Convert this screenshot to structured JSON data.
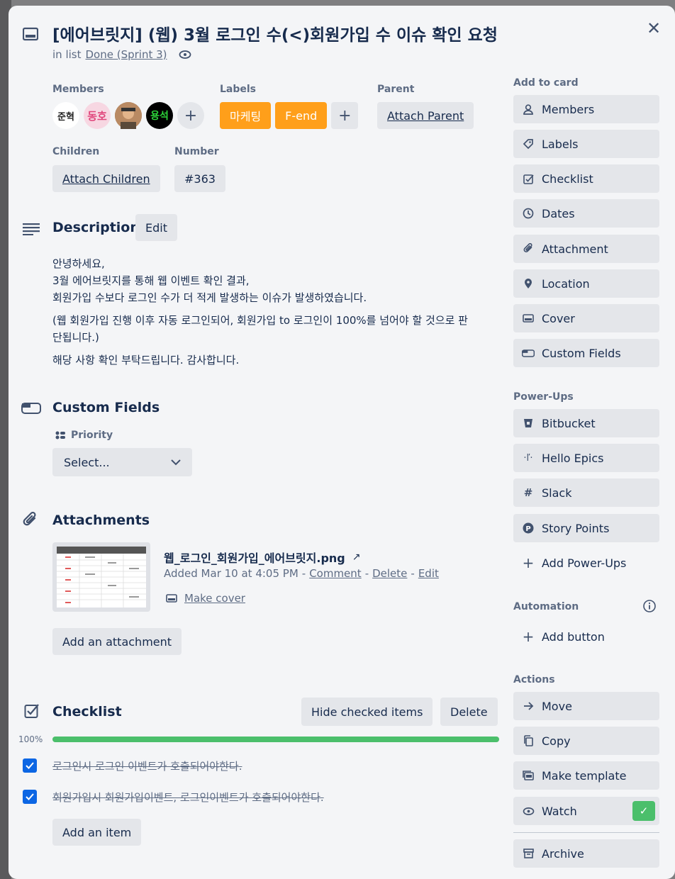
{
  "card": {
    "title": "[에어브릿지] (웹) 3월 로그인 수(<)회원가입 수 이슈 확인 요청",
    "in_list_prefix": "in list",
    "list_name": "Done (Sprint 3)"
  },
  "members": {
    "heading": "Members",
    "avatars": [
      "준혁",
      "동호",
      "",
      "용석"
    ]
  },
  "labels": {
    "heading": "Labels",
    "items": [
      "마케팅",
      "F-end"
    ],
    "color": "#ff9f1a"
  },
  "parent": {
    "heading": "Parent",
    "button": "Attach Parent"
  },
  "children": {
    "heading": "Children",
    "button": "Attach Children"
  },
  "number": {
    "heading": "Number",
    "value": "#363"
  },
  "description": {
    "heading": "Description",
    "edit_button": "Edit",
    "lines": [
      "안녕하세요,",
      "3월 에어브릿지를 통해 웹 이벤트 확인 결과,",
      "회원가입 수보다 로그인 수가 더 적게 발생하는 이슈가 발생하였습니다.",
      "(웹 회원가입 진행 이후 자동 로그인되어, 회원가입 to 로그인이 100%를 넘어야 할 것으로 판",
      "단됩니다.)",
      "해당 사항 확인 부탁드립니다. 감사합니다."
    ]
  },
  "custom_fields": {
    "heading": "Custom Fields",
    "priority_label": "Priority",
    "priority_value": "Select..."
  },
  "attachments": {
    "heading": "Attachments",
    "file_name": "웹_로그인_회원가입_에어브릿지.png",
    "added": "Added Mar 10 at 4:05 PM",
    "sep": "-",
    "comment": "Comment",
    "delete": "Delete",
    "edit": "Edit",
    "make_cover": "Make cover",
    "add_button": "Add an attachment"
  },
  "checklist": {
    "heading": "Checklist",
    "hide_checked": "Hide checked items",
    "delete": "Delete",
    "progress_text": "100%",
    "progress": 1.0,
    "progress_color": "#4bbf6b",
    "items": [
      "로그인시 로그인 이벤트가 호출되어야한다.",
      "회원가입시 회원가입이벤트, 로그인이벤트가 호출되어야한다."
    ],
    "add_item": "Add an item"
  },
  "sidebar": {
    "add_to_card": "Add to card",
    "add_items": [
      "Members",
      "Labels",
      "Checklist",
      "Dates",
      "Attachment",
      "Location",
      "Cover",
      "Custom Fields"
    ],
    "power_ups": "Power-Ups",
    "power_up_items": [
      "Bitbucket",
      "Hello Epics",
      "Slack",
      "Story Points",
      "Add Power-Ups"
    ],
    "automation": "Automation",
    "add_button": "Add button",
    "actions": "Actions",
    "action_items": [
      "Move",
      "Copy",
      "Make template",
      "Watch",
      "Archive"
    ]
  }
}
